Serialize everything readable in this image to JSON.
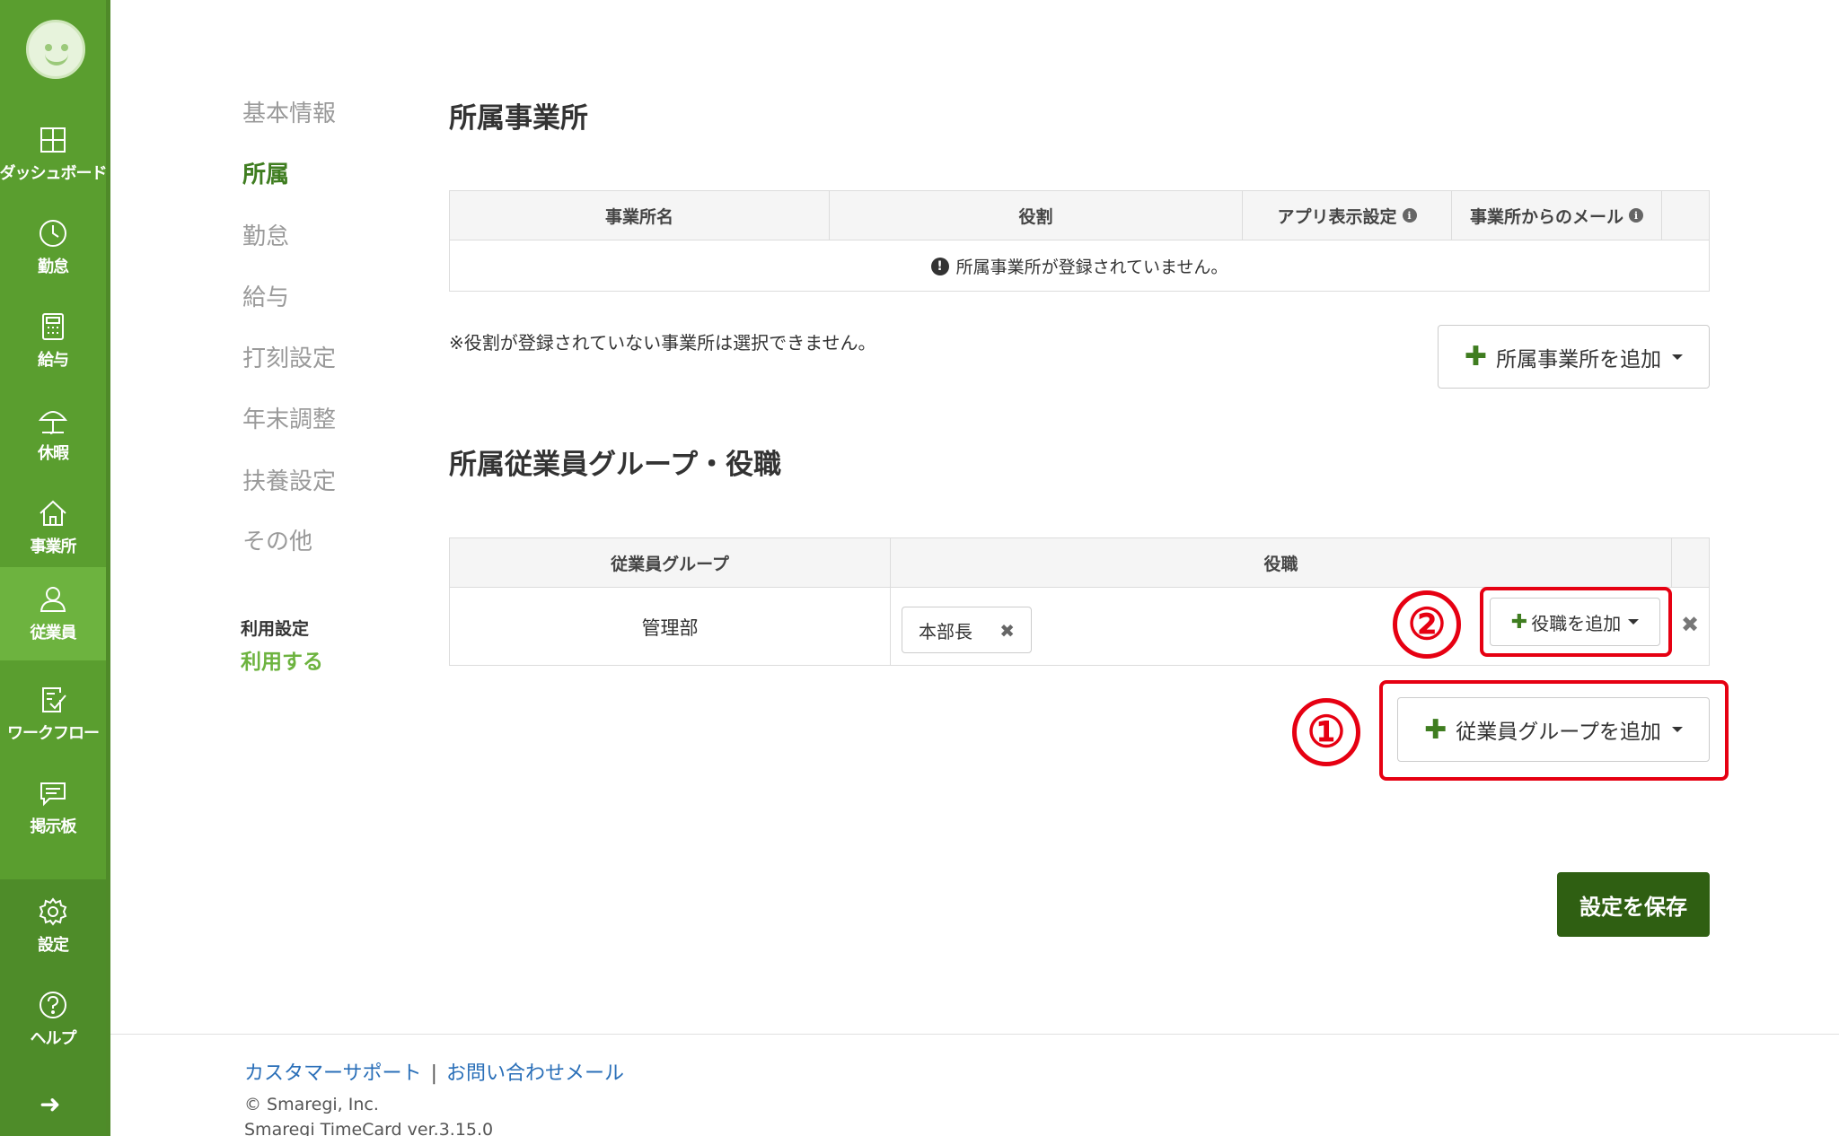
{
  "sidebar": {
    "items": [
      {
        "label": "ダッシュボード",
        "icon": "dashboard-icon"
      },
      {
        "label": "勤怠",
        "icon": "clock-icon"
      },
      {
        "label": "給与",
        "icon": "calculator-icon"
      },
      {
        "label": "休暇",
        "icon": "umbrella-icon"
      },
      {
        "label": "事業所",
        "icon": "home-icon"
      },
      {
        "label": "従業員",
        "icon": "user-icon"
      },
      {
        "label": "ワークフロー",
        "icon": "workflow-icon"
      },
      {
        "label": "掲示板",
        "icon": "chat-icon"
      },
      {
        "label": "設定",
        "icon": "gear-icon"
      },
      {
        "label": "ヘルプ",
        "icon": "help-icon"
      }
    ],
    "active": "従業員"
  },
  "subnav": {
    "items": [
      "基本情報",
      "所属",
      "勤怠",
      "給与",
      "打刻設定",
      "年末調整",
      "扶養設定",
      "その他"
    ],
    "active": "所属",
    "usage_label": "利用設定",
    "usage_value": "利用する"
  },
  "office_section": {
    "title": "所属事業所",
    "columns": [
      "事業所名",
      "役割",
      "アプリ表示設定",
      "事業所からのメール"
    ],
    "empty_message": "所属事業所が登録されていません。",
    "note": "※役割が登録されていない事業所は選択できません。",
    "add_button": "所属事業所を追加"
  },
  "group_section": {
    "title": "所属従業員グループ・役職",
    "columns": [
      "従業員グループ",
      "役職"
    ],
    "rows": [
      {
        "group": "管理部",
        "positions": [
          "本部長"
        ]
      }
    ],
    "add_position_button": "役職を追加",
    "add_group_button": "従業員グループを追加"
  },
  "annotations": {
    "marker_1": "①",
    "marker_2": "②",
    "color": "#e60012"
  },
  "save_button": "設定を保存",
  "footer": {
    "support_link": "カスタマーサポート",
    "separator": "|",
    "contact_link": "お問い合わせメール",
    "copyright": "© Smaregi, Inc.",
    "version": "Smaregi TimeCard ver.3.15.0"
  },
  "colors": {
    "sidebar": "#5a9e2f",
    "accent": "#3f7d20",
    "save_button": "#2f5f12"
  }
}
